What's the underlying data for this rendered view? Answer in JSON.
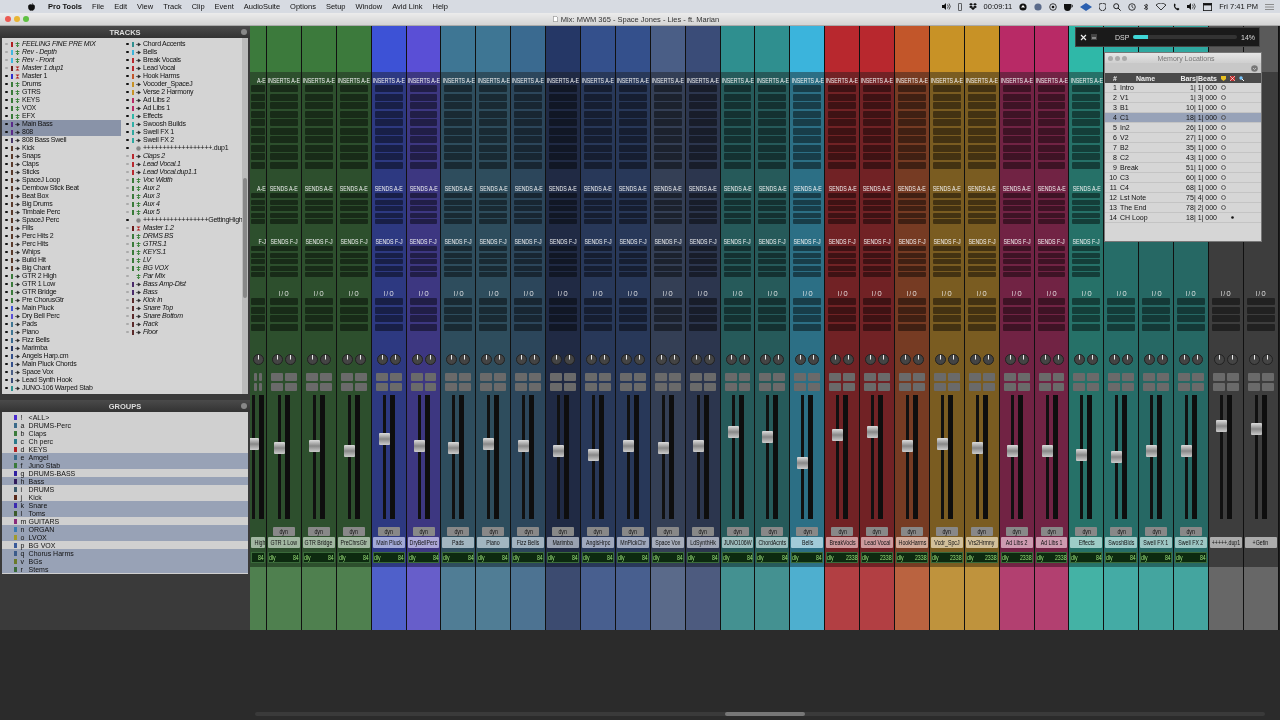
{
  "menu_bar": {
    "app": "Pro Tools",
    "items": [
      "File",
      "Edit",
      "View",
      "Track",
      "Clip",
      "Event",
      "AudioSuite",
      "Options",
      "Setup",
      "Window",
      "Avid Link",
      "Help"
    ],
    "clock": "00:09:11",
    "datetime": "Fri 7:41 PM"
  },
  "window": {
    "title": "Mix: MWM 365 - Space Jones - Lies - ft. Marian"
  },
  "tracks": {
    "title": "TRACKS",
    "items": [
      {
        "name": "FEELING FINE PRE MIX",
        "kind": "aux",
        "color": "#b02020",
        "inactive": true,
        "selected": false
      },
      {
        "name": "Rev - Depth",
        "kind": "aux",
        "color": "#40b8e0",
        "inactive": true,
        "selected": false
      },
      {
        "name": "Rev - Front",
        "kind": "aux",
        "color": "#40b8e0",
        "inactive": true,
        "selected": false
      },
      {
        "name": "Master 1.dup1",
        "kind": "master",
        "color": "#6a1a1a",
        "inactive": true,
        "selected": false
      },
      {
        "name": "Master 1",
        "kind": "master",
        "color": "#3030d0",
        "inactive": false,
        "selected": false
      },
      {
        "name": "Drums",
        "kind": "aux",
        "color": "#3a7a3a",
        "inactive": false,
        "selected": false
      },
      {
        "name": "GTRS",
        "kind": "aux",
        "color": "#3a7a3a",
        "inactive": false,
        "selected": false
      },
      {
        "name": "KEYS",
        "kind": "aux",
        "color": "#3a7a3a",
        "inactive": false,
        "selected": false
      },
      {
        "name": "VOX",
        "kind": "aux",
        "color": "#3a7a3a",
        "inactive": false,
        "selected": false
      },
      {
        "name": "EFX",
        "kind": "aux",
        "color": "#3a7a3a",
        "inactive": false,
        "selected": false
      },
      {
        "name": "Main Bass",
        "kind": "audio",
        "color": "#5a2a8a",
        "inactive": false,
        "selected": true
      },
      {
        "name": "808",
        "kind": "audio",
        "color": "#5a2a8a",
        "inactive": false,
        "selected": true
      },
      {
        "name": "808 Bass Swell",
        "kind": "audio",
        "color": "#4a3a6a",
        "inactive": false,
        "selected": false
      },
      {
        "name": "Kick",
        "kind": "audio",
        "color": "#5a3a2a",
        "inactive": false,
        "selected": false
      },
      {
        "name": "Snaps",
        "kind": "audio",
        "color": "#5a3a2a",
        "inactive": false,
        "selected": false
      },
      {
        "name": "Claps",
        "kind": "audio",
        "color": "#5a3a2a",
        "inactive": false,
        "selected": false
      },
      {
        "name": "Sticks",
        "kind": "audio",
        "color": "#5a3a2a",
        "inactive": false,
        "selected": false
      },
      {
        "name": "SpaceJ Loop",
        "kind": "audio",
        "color": "#5a3a2a",
        "inactive": false,
        "selected": false
      },
      {
        "name": "Dembow Stick Beat",
        "kind": "audio",
        "color": "#5a3a2a",
        "inactive": false,
        "selected": false
      },
      {
        "name": "Beat Box",
        "kind": "audio",
        "color": "#5a3a2a",
        "inactive": false,
        "selected": false
      },
      {
        "name": "Big Drums",
        "kind": "audio",
        "color": "#5a3a2a",
        "inactive": false,
        "selected": false
      },
      {
        "name": "Timbale Perc",
        "kind": "audio",
        "color": "#5a3a2a",
        "inactive": false,
        "selected": false
      },
      {
        "name": "SpaceJ Perc",
        "kind": "audio",
        "color": "#5a3a2a",
        "inactive": false,
        "selected": false
      },
      {
        "name": "Fills",
        "kind": "audio",
        "color": "#5a3a2a",
        "inactive": false,
        "selected": false
      },
      {
        "name": "Perc Hits 2",
        "kind": "audio",
        "color": "#5a3a2a",
        "inactive": false,
        "selected": false
      },
      {
        "name": "Perc Hits",
        "kind": "audio",
        "color": "#5a3a2a",
        "inactive": false,
        "selected": false
      },
      {
        "name": "Whips",
        "kind": "audio",
        "color": "#5a3a2a",
        "inactive": false,
        "selected": false
      },
      {
        "name": "Build Hit",
        "kind": "audio",
        "color": "#5a3a2a",
        "inactive": false,
        "selected": false
      },
      {
        "name": "Big Chant",
        "kind": "audio",
        "color": "#5a3a2a",
        "inactive": false,
        "selected": false
      },
      {
        "name": "GTR 2 High",
        "kind": "audio",
        "color": "#3a7a3a",
        "inactive": false,
        "selected": false
      },
      {
        "name": "GTR 1 Low",
        "kind": "audio",
        "color": "#3a7a3a",
        "inactive": false,
        "selected": false
      },
      {
        "name": "GTR Bridge",
        "kind": "audio",
        "color": "#3a7a3a",
        "inactive": false,
        "selected": false
      },
      {
        "name": "Pre ChorusGtr",
        "kind": "audio",
        "color": "#3a7a3a",
        "inactive": false,
        "selected": false
      },
      {
        "name": "Main Pluck",
        "kind": "audio",
        "color": "#3d52d6",
        "inactive": false,
        "selected": false
      },
      {
        "name": "Dry Bell Perc",
        "kind": "audio",
        "color": "#5a4fd6",
        "inactive": false,
        "selected": false
      },
      {
        "name": "Pads",
        "kind": "audio",
        "color": "#3e7694",
        "inactive": false,
        "selected": false
      },
      {
        "name": "Piano",
        "kind": "audio",
        "color": "#3e7694",
        "inactive": false,
        "selected": false
      },
      {
        "name": "Fizz Bells",
        "kind": "audio",
        "color": "#3a6a90",
        "inactive": false,
        "selected": false
      },
      {
        "name": "Marimba",
        "kind": "audio",
        "color": "#253766",
        "inactive": false,
        "selected": false
      },
      {
        "name": "Angels Harp.cm",
        "kind": "audio",
        "color": "#34508c",
        "inactive": false,
        "selected": false
      },
      {
        "name": "Main Pluck Chords",
        "kind": "audio",
        "color": "#34508c",
        "inactive": false,
        "selected": false
      },
      {
        "name": "Space Vox",
        "kind": "audio",
        "color": "#4a5e86",
        "inactive": false,
        "selected": false
      },
      {
        "name": "Lead Synth Hook",
        "kind": "audio",
        "color": "#3a4c78",
        "inactive": false,
        "selected": false
      },
      {
        "name": "JUNO-106 Warped Stab",
        "kind": "audio",
        "color": "#2f8f8f",
        "inactive": false,
        "selected": false
      },
      {
        "name": "Chord Accents",
        "kind": "audio",
        "color": "#2f8f8f",
        "inactive": false,
        "selected": false
      },
      {
        "name": "Bells",
        "kind": "audio",
        "color": "#3bb4dc",
        "inactive": false,
        "selected": false
      },
      {
        "name": "Break Vocals",
        "kind": "audio",
        "color": "#b8282e",
        "inactive": false,
        "selected": false
      },
      {
        "name": "Lead Vocal",
        "kind": "audio",
        "color": "#b8282e",
        "inactive": false,
        "selected": false
      },
      {
        "name": "Hook Harms",
        "kind": "audio",
        "color": "#c2562a",
        "inactive": false,
        "selected": false
      },
      {
        "name": "Vocoder_SpaceJ",
        "kind": "audio",
        "color": "#c89226",
        "inactive": false,
        "selected": false
      },
      {
        "name": "Verse 2 Harmony",
        "kind": "audio",
        "color": "#c89226",
        "inactive": false,
        "selected": false
      },
      {
        "name": "Ad Libs 2",
        "kind": "audio",
        "color": "#b82a66",
        "inactive": false,
        "selected": false
      },
      {
        "name": "Ad Libs 1",
        "kind": "audio",
        "color": "#b82a66",
        "inactive": false,
        "selected": false
      },
      {
        "name": "Effects",
        "kind": "audio",
        "color": "#2fb8a8",
        "inactive": false,
        "selected": false
      },
      {
        "name": "Swoosh Builds",
        "kind": "audio",
        "color": "#2fb0a8",
        "inactive": false,
        "selected": false
      },
      {
        "name": "Swell FX 1",
        "kind": "audio",
        "color": "#2fa8a0",
        "inactive": false,
        "selected": false
      },
      {
        "name": "Swell FX 2",
        "kind": "audio",
        "color": "#2fa8a0",
        "inactive": false,
        "selected": false
      },
      {
        "name": "++++++++++++++++++.dup1",
        "kind": "divider",
        "inactive": false,
        "selected": false
      },
      {
        "name": "Claps 2",
        "kind": "audio",
        "color": "#b8282e",
        "inactive": true,
        "selected": false
      },
      {
        "name": "Lead Vocal.1",
        "kind": "audio",
        "color": "#b8282e",
        "inactive": true,
        "selected": false
      },
      {
        "name": "Lead Vocal.dup1.1",
        "kind": "audio",
        "color": "#b8282e",
        "inactive": true,
        "selected": false
      },
      {
        "name": "Voc Width",
        "kind": "aux",
        "color": "#3a7a3a",
        "inactive": true,
        "selected": false
      },
      {
        "name": "Aux 2",
        "kind": "aux",
        "color": "#3a7a3a",
        "inactive": true,
        "selected": false
      },
      {
        "name": "Aux 3",
        "kind": "aux",
        "color": "#3a7a3a",
        "inactive": true,
        "selected": false
      },
      {
        "name": "Aux 4",
        "kind": "aux",
        "color": "#3a7a3a",
        "inactive": true,
        "selected": false
      },
      {
        "name": "Aux 5",
        "kind": "aux",
        "color": "#3a7a3a",
        "inactive": true,
        "selected": false
      },
      {
        "name": "+++++++++++++++++GettingHigh",
        "kind": "divider",
        "inactive": false,
        "selected": false
      },
      {
        "name": "Master 1.2",
        "kind": "master",
        "color": "#6a1a1a",
        "inactive": true,
        "selected": false
      },
      {
        "name": "DRMS BS",
        "kind": "aux",
        "color": "#3a7a3a",
        "inactive": true,
        "selected": false
      },
      {
        "name": "GTRS.1",
        "kind": "aux",
        "color": "#3a7a3a",
        "inactive": true,
        "selected": false
      },
      {
        "name": "KEYS.1",
        "kind": "aux",
        "color": "#3a7a3a",
        "inactive": true,
        "selected": false
      },
      {
        "name": "LV",
        "kind": "aux",
        "color": "#3a7a3a",
        "inactive": true,
        "selected": false
      },
      {
        "name": "BG VOX",
        "kind": "aux",
        "color": "#3a7a3a",
        "inactive": true,
        "selected": false
      },
      {
        "name": "Par Mix",
        "kind": "aux",
        "inactive": true,
        "selected": false
      },
      {
        "name": "Bass Amp-Dist",
        "kind": "audio",
        "color": "#4a2a6a",
        "inactive": true,
        "selected": false
      },
      {
        "name": "Bass",
        "kind": "audio",
        "color": "#4a2a6a",
        "inactive": true,
        "selected": false
      },
      {
        "name": "Kick In",
        "kind": "audio",
        "color": "#5a2a2a",
        "inactive": true,
        "selected": false
      },
      {
        "name": "Snare Top",
        "kind": "audio",
        "color": "#5a2a2a",
        "inactive": true,
        "selected": false
      },
      {
        "name": "Snare Bottom",
        "kind": "audio",
        "color": "#5a2a2a",
        "inactive": true,
        "selected": false
      },
      {
        "name": "Rack",
        "kind": "audio",
        "color": "#5a2a2a",
        "inactive": true,
        "selected": false
      },
      {
        "name": "Floor",
        "kind": "audio",
        "color": "#5a2a2a",
        "inactive": true,
        "selected": false
      }
    ]
  },
  "groups": {
    "title": "GROUPS",
    "items": [
      {
        "letter": "!",
        "name": "<ALL>",
        "color": "#4a2ad0",
        "selected": false
      },
      {
        "letter": "a",
        "name": "DRUMS-Perc",
        "color": "#3a6a8a",
        "selected": false
      },
      {
        "letter": "b",
        "name": "Claps",
        "color": "#3a7a3a",
        "selected": false
      },
      {
        "letter": "c",
        "name": "Ch perc",
        "color": "#2a7a8a",
        "selected": false
      },
      {
        "letter": "d",
        "name": "KEYS",
        "color": "#b02020",
        "selected": false
      },
      {
        "letter": "e",
        "name": "Amgel",
        "color": "#3a6a8a",
        "selected": true
      },
      {
        "letter": "f",
        "name": "Juno Stab",
        "color": "#3a7a3a",
        "selected": true
      },
      {
        "letter": "g",
        "name": "DRUMS-BASS",
        "color": "#3020a0",
        "selected": false
      },
      {
        "letter": "h",
        "name": "Bass",
        "color": "#301a5a",
        "selected": true
      },
      {
        "letter": "i",
        "name": "DRUMS",
        "color": "#3a5a6a",
        "selected": false
      },
      {
        "letter": "j",
        "name": "Kick",
        "color": "#5a2a1a",
        "selected": false
      },
      {
        "letter": "k",
        "name": "Snare",
        "color": "#3a2ab0",
        "selected": true
      },
      {
        "letter": "l",
        "name": "Toms",
        "color": "#3a5a2a",
        "selected": true
      },
      {
        "letter": "m",
        "name": "GUITARS",
        "color": "#8a2a7a",
        "selected": false
      },
      {
        "letter": "n",
        "name": "ORGAN",
        "color": "#3a7ab0",
        "selected": true
      },
      {
        "letter": "o",
        "name": "LVOX",
        "color": "#a09a2a",
        "selected": true
      },
      {
        "letter": "p",
        "name": "BG VOX",
        "color": "#3a5a9a",
        "selected": false
      },
      {
        "letter": "q",
        "name": "Chorus Harms",
        "color": "#3a5a8a",
        "selected": true
      },
      {
        "letter": "v",
        "name": "BGs",
        "color": "#6a7a2a",
        "selected": true
      },
      {
        "letter": "r",
        "name": "Stems",
        "color": "#3a6a3a",
        "selected": true
      }
    ]
  },
  "strips": [
    {
      "name": "High",
      "color": "#3c7a3c",
      "level": 0.62,
      "inserts": "A-E",
      "sends_ae": "A-E",
      "sends_fj": "F-J",
      "delay": "84"
    },
    {
      "name": "GTR 1 Low",
      "color": "#3c7a3c",
      "level": 0.58,
      "inserts": "INSERTS A-E",
      "sends_ae": "SENDS A-E",
      "sends_fj": "SENDS F-J",
      "io": "I / O",
      "dyn": "dyn",
      "delay_label": "dly",
      "delay": "84"
    },
    {
      "name": "GTR Bridge",
      "color": "#3c7a3c",
      "level": 0.6,
      "inserts": "INSERTS A-E",
      "sends_ae": "SENDS A-E",
      "sends_fj": "SENDS F-J",
      "io": "I / O",
      "dyn": "dyn",
      "delay_label": "dly",
      "delay": "84"
    },
    {
      "name": "PreChrsGtr",
      "color": "#3c7a3c",
      "level": 0.55,
      "inserts": "INSERTS A-E",
      "sends_ae": "SENDS A-E",
      "sends_fj": "SENDS F-J",
      "io": "I / O",
      "dyn": "dyn",
      "delay_label": "dly",
      "delay": "84"
    },
    {
      "name": "Main Pluck",
      "color": "#3d52d6",
      "level": 0.66,
      "inserts": "INSERTS A-E",
      "sends_ae": "SENDS A-E",
      "sends_fj": "SENDS F-J",
      "io": "I / O",
      "dyn": "dyn",
      "delay_label": "dly",
      "delay": "84"
    },
    {
      "name": "DryBellPerc",
      "color": "#5a4fd6",
      "level": 0.6,
      "inserts": "INSERTS A-E",
      "sends_ae": "SENDS A-E",
      "sends_fj": "SENDS F-J",
      "io": "I / O",
      "dyn": "dyn",
      "delay_label": "dly",
      "delay": "84"
    },
    {
      "name": "Pads",
      "color": "#3e7694",
      "level": 0.58,
      "inserts": "INSERTS A-E",
      "sends_ae": "SENDS A-E",
      "sends_fj": "SENDS F-J",
      "io": "I / O",
      "dyn": "dyn",
      "delay_label": "dly",
      "delay": "84"
    },
    {
      "name": "Piano",
      "color": "#3e7694",
      "level": 0.62,
      "inserts": "INSERTS A-E",
      "sends_ae": "SENDS A-E",
      "sends_fj": "SENDS F-J",
      "io": "I / O",
      "dyn": "dyn",
      "delay_label": "dly",
      "delay": "84"
    },
    {
      "name": "Fizz Bells",
      "color": "#3a6a90",
      "level": 0.6,
      "inserts": "INSERTS A-E",
      "sends_ae": "SENDS A-E",
      "sends_fj": "SENDS F-J",
      "io": "I / O",
      "dyn": "dyn",
      "delay_label": "dly",
      "delay": "84"
    },
    {
      "name": "Marimba",
      "color": "#253766",
      "level": 0.55,
      "inserts": "INSERTS A-E",
      "sends_ae": "SENDS A-E",
      "sends_fj": "SENDS F-J",
      "io": "I / O",
      "dyn": "dyn",
      "delay_label": "dly",
      "delay": "84"
    },
    {
      "name": "AnglsHrpc",
      "color": "#34508c",
      "level": 0.52,
      "inserts": "INSERTS A-E",
      "sends_ae": "SENDS A-E",
      "sends_fj": "SENDS F-J",
      "io": "I / O",
      "dyn": "dyn",
      "delay_label": "dly",
      "delay": "84"
    },
    {
      "name": "MnPlckChr",
      "color": "#34508c",
      "level": 0.6,
      "inserts": "INSERTS A-E",
      "sends_ae": "SENDS A-E",
      "sends_fj": "SENDS F-J",
      "io": "I / O",
      "dyn": "dyn",
      "delay_label": "dly",
      "delay": "84"
    },
    {
      "name": "Space Vox",
      "color": "#4a5e86",
      "level": 0.58,
      "inserts": "INSERTS A-E",
      "sends_ae": "SENDS A-E",
      "sends_fj": "SENDS F-J",
      "io": "I / O",
      "dyn": "dyn",
      "delay_label": "dly",
      "delay": "84"
    },
    {
      "name": "LdSynthHk",
      "color": "#3a4c78",
      "level": 0.6,
      "inserts": "INSERTS A-E",
      "sends_ae": "SENDS A-E",
      "sends_fj": "SENDS F-J",
      "io": "I / O",
      "dyn": "dyn",
      "delay_label": "dly",
      "delay": "84"
    },
    {
      "name": "JUNO106W",
      "color": "#2f8f8f",
      "level": 0.72,
      "inserts": "INSERTS A-E",
      "sends_ae": "SENDS A-E",
      "sends_fj": "SENDS F-J",
      "io": "I / O",
      "dyn": "dyn",
      "delay_label": "dly",
      "delay": "84"
    },
    {
      "name": "ChordAcnts",
      "color": "#2f8f8f",
      "level": 0.68,
      "inserts": "INSERTS A-E",
      "sends_ae": "SENDS A-E",
      "sends_fj": "SENDS F-J",
      "io": "I / O",
      "dyn": "dyn",
      "delay_label": "dly",
      "delay": "84"
    },
    {
      "name": "Bells",
      "color": "#3bb4dc",
      "level": 0.45,
      "inserts": "INSERTS A-E",
      "sends_ae": "SENDS A-E",
      "sends_fj": "SENDS F-J",
      "io": "I / O",
      "dyn": "dyn",
      "delay_label": "dly",
      "delay": "84"
    },
    {
      "name": "BreakVocls",
      "color": "#b8282e",
      "level": 0.7,
      "inserts": "INSERTS A-E",
      "sends_ae": "SENDS A-E",
      "sends_fj": "SENDS F-J",
      "io": "I / O",
      "dyn": "dyn",
      "delay_label": "dly",
      "delay": "2338"
    },
    {
      "name": "Lead Vocal",
      "color": "#b8282e",
      "level": 0.72,
      "inserts": "INSERTS A-E",
      "sends_ae": "SENDS A-E",
      "sends_fj": "SENDS F-J",
      "io": "I / O",
      "dyn": "dyn",
      "delay_label": "dly",
      "delay": "2338"
    },
    {
      "name": "HookHarms",
      "color": "#c2562a",
      "level": 0.6,
      "inserts": "INSERTS A-E",
      "sends_ae": "SENDS A-E",
      "sends_fj": "SENDS F-J",
      "io": "I / O",
      "dyn": "dyn",
      "delay_label": "dly",
      "delay": "2338"
    },
    {
      "name": "Vcdr_SpcJ",
      "color": "#c89226",
      "level": 0.62,
      "inserts": "INSERTS A-E",
      "sends_ae": "SENDS A-E",
      "sends_fj": "SENDS F-J",
      "io": "I / O",
      "dyn": "dyn",
      "delay_label": "dly",
      "delay": "2338"
    },
    {
      "name": "Vrs2Hrmny",
      "color": "#c89226",
      "level": 0.58,
      "inserts": "INSERTS A-E",
      "sends_ae": "SENDS A-E",
      "sends_fj": "SENDS F-J",
      "io": "I / O",
      "dyn": "dyn",
      "delay_label": "dly",
      "delay": "2338"
    },
    {
      "name": "Ad Libs 2",
      "color": "#b82a66",
      "level": 0.55,
      "inserts": "INSERTS A-E",
      "sends_ae": "SENDS A-E",
      "sends_fj": "SENDS F-J",
      "io": "I / O",
      "dyn": "dyn",
      "delay_label": "dly",
      "delay": "2338"
    },
    {
      "name": "Ad Libs 1",
      "color": "#b82a66",
      "level": 0.55,
      "inserts": "INSERTS A-E",
      "sends_ae": "SENDS A-E",
      "sends_fj": "SENDS F-J",
      "io": "I / O",
      "dyn": "dyn",
      "delay_label": "dly",
      "delay": "2338"
    },
    {
      "name": "Effects",
      "color": "#2fb8a8",
      "level": 0.52,
      "inserts": "INSERTS A-E",
      "sends_ae": "SENDS A-E",
      "sends_fj": "SENDS F-J",
      "io": "I / O",
      "dyn": "dyn",
      "delay_label": "dly",
      "delay": "84"
    },
    {
      "name": "SwoshBlds",
      "color": "#2fb0a8",
      "level": 0.5,
      "io": "I / O",
      "dyn": "dyn",
      "delay_label": "dly",
      "delay": "84"
    },
    {
      "name": "Swell FX 1",
      "color": "#2fa8a0",
      "level": 0.55,
      "io": "I / O",
      "dyn": "dyn",
      "delay_label": "dly",
      "delay": "84"
    },
    {
      "name": "Swell FX 2",
      "color": "#2fa8a0",
      "level": 0.55,
      "io": "I / O",
      "dyn": "dyn",
      "delay_label": "dly",
      "delay": "84"
    },
    {
      "name": "+++++.dup1",
      "color": "#5a5a5a",
      "level": 0.78,
      "io": "I / O"
    },
    {
      "name": "+Getin",
      "color": "#5a5a5a",
      "level": 0.75,
      "io": "I / O"
    }
  ],
  "dsp": {
    "label": "DSP",
    "level": 0.14,
    "reading": "14%"
  },
  "memory_locations": {
    "title": "Memory Locations",
    "columns": [
      "#",
      "Name",
      "Bars|Beats"
    ],
    "rows": [
      {
        "number": "1",
        "name": "Intro",
        "position": "1| 1| 000",
        "kind": "marker",
        "selected": false
      },
      {
        "number": "2",
        "name": "V1",
        "position": "1| 3| 000",
        "kind": "marker",
        "selected": false
      },
      {
        "number": "3",
        "name": "B1",
        "position": "10| 1| 000",
        "kind": "marker",
        "selected": false
      },
      {
        "number": "4",
        "name": "C1",
        "position": "18| 1| 000",
        "kind": "marker",
        "selected": true
      },
      {
        "number": "5",
        "name": "In2",
        "position": "26| 1| 000",
        "kind": "marker",
        "selected": false
      },
      {
        "number": "6",
        "name": "V2",
        "position": "27| 1| 000",
        "kind": "marker",
        "selected": false
      },
      {
        "number": "7",
        "name": "B2",
        "position": "35| 1| 000",
        "kind": "marker",
        "selected": false
      },
      {
        "number": "8",
        "name": "C2",
        "position": "43| 1| 000",
        "kind": "marker",
        "selected": false
      },
      {
        "number": "9",
        "name": "Break",
        "position": "51| 1| 000",
        "kind": "marker",
        "selected": false
      },
      {
        "number": "10",
        "name": "C3",
        "position": "60| 1| 000",
        "kind": "marker",
        "selected": false
      },
      {
        "number": "11",
        "name": "C4",
        "position": "68| 1| 000",
        "kind": "marker",
        "selected": false
      },
      {
        "number": "12",
        "name": "Lst Note",
        "position": "75| 4| 000",
        "kind": "marker",
        "selected": false
      },
      {
        "number": "13",
        "name": "The End",
        "position": "78| 2| 000",
        "kind": "marker",
        "selected": false
      },
      {
        "number": "14",
        "name": "CH Loop",
        "position": "18| 1| 000",
        "kind": "selection",
        "selected": false
      }
    ]
  }
}
